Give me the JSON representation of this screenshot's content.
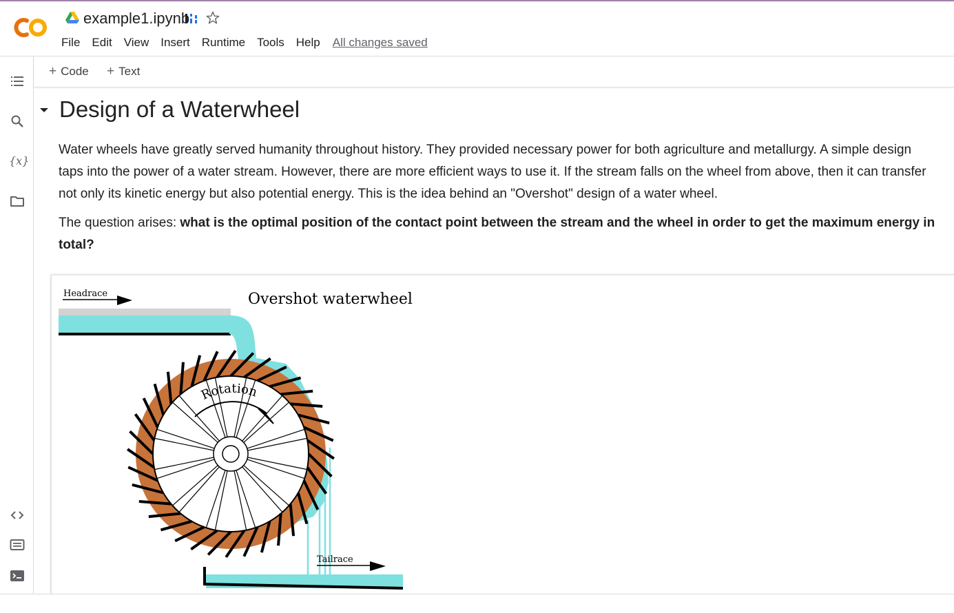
{
  "app": {
    "filename": "example1.ipynb",
    "menu": [
      "File",
      "Edit",
      "View",
      "Insert",
      "Runtime",
      "Tools",
      "Help"
    ],
    "save_status": "All changes saved"
  },
  "toolbar": {
    "code_label": "Code",
    "text_label": "Text"
  },
  "sidebar": {
    "icons": [
      "table-of-contents-icon",
      "search-icon",
      "variables-icon",
      "files-icon",
      "code-snippets-icon",
      "command-palette-icon",
      "terminal-icon"
    ],
    "variables_glyph": "{x}"
  },
  "notebook": {
    "heading": "Design of a Waterwheel",
    "paragraph1": "Water wheels have greatly served humanity throughout history. They provided necessary power for both agriculture and metallurgy. A simple design taps into the power of a water stream. However, there are more efficient ways to use it. If the stream falls on the wheel from above, then it can transfer not only its kinetic energy but also potential energy. This is the idea behind an \"Overshot\" design of a water wheel.",
    "paragraph2_intro": "The question arises: ",
    "paragraph2_bold": "what is the optimal position of the contact point between the stream and the wheel in order to get the maximum energy in total?"
  },
  "figure": {
    "title": "Overshot waterwheel",
    "headrace_label": "Headrace",
    "tailrace_label": "Tailrace",
    "rotation_label": "Rotation",
    "colors": {
      "water": "#7fe0e0",
      "wood": "#c8733a",
      "channel": "#d3d3d3"
    }
  },
  "colors": {
    "accent_orange": "#f9ab00",
    "brand_orange": "#e8710a",
    "border": "#dadce0"
  }
}
